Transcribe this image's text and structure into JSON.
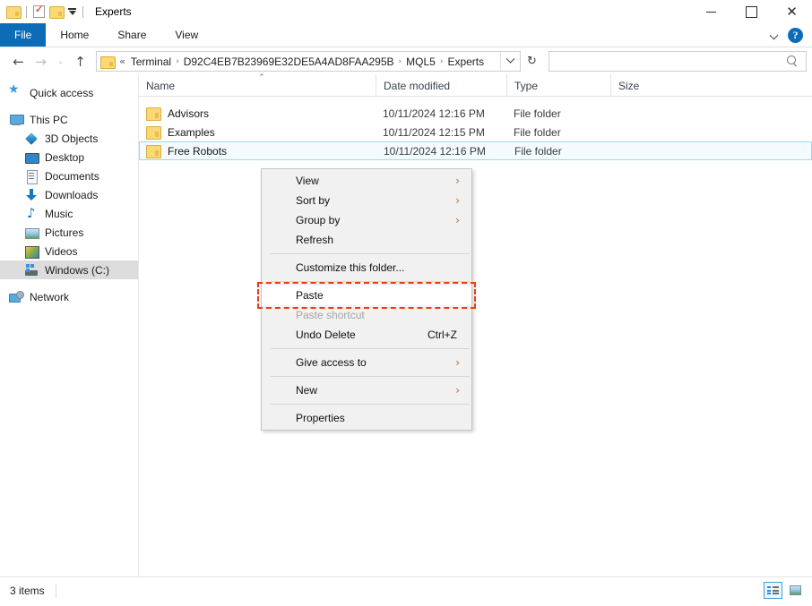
{
  "window": {
    "title": "Experts",
    "quick_access": [
      "folder-icon",
      "properties-icon",
      "new-folder-icon"
    ],
    "controls": {
      "minimize": "minimize-icon",
      "maximize": "maximize-icon",
      "close": "✕"
    }
  },
  "ribbon": {
    "tabs": [
      {
        "label": "File",
        "active": true
      },
      {
        "label": "Home",
        "active": false
      },
      {
        "label": "Share",
        "active": false
      },
      {
        "label": "View",
        "active": false
      }
    ],
    "expand_icon": "chevron-down-icon",
    "help_label": "?"
  },
  "navigation": {
    "back": "←",
    "forward": "→",
    "recent": "⌄",
    "up": "↑",
    "refresh": "↻",
    "address_caret": "chevron-down-icon",
    "breadcrumb": {
      "overflow": "«",
      "items": [
        "Terminal",
        "D92C4EB7B23969E32DE5A4AD8FAA295B",
        "MQL5",
        "Experts"
      ],
      "separator": "›"
    },
    "search": {
      "value": "",
      "placeholder": "",
      "icon": "search-icon"
    }
  },
  "sidebar": {
    "items": [
      {
        "label": "Quick access",
        "icon": "star-icon",
        "indent": false,
        "selected": false
      },
      {
        "label": "This PC",
        "icon": "computer-icon",
        "indent": false,
        "selected": false
      },
      {
        "label": "3D Objects",
        "icon": "3d-objects-icon",
        "indent": true,
        "selected": false
      },
      {
        "label": "Desktop",
        "icon": "desktop-icon",
        "indent": true,
        "selected": false
      },
      {
        "label": "Documents",
        "icon": "documents-icon",
        "indent": true,
        "selected": false
      },
      {
        "label": "Downloads",
        "icon": "downloads-icon",
        "indent": true,
        "selected": false
      },
      {
        "label": "Music",
        "icon": "music-icon",
        "indent": true,
        "selected": false
      },
      {
        "label": "Pictures",
        "icon": "pictures-icon",
        "indent": true,
        "selected": false
      },
      {
        "label": "Videos",
        "icon": "videos-icon",
        "indent": true,
        "selected": false
      },
      {
        "label": "Windows (C:)",
        "icon": "drive-icon",
        "indent": true,
        "selected": true
      },
      {
        "label": "Network",
        "icon": "network-icon",
        "indent": false,
        "selected": false
      }
    ]
  },
  "filelist": {
    "columns": [
      "Name",
      "Date modified",
      "Type",
      "Size"
    ],
    "sort_indicator": "⌃",
    "rows": [
      {
        "name": "Advisors",
        "date": "10/11/2024 12:16 PM",
        "type": "File folder",
        "size": "",
        "selected": false
      },
      {
        "name": "Examples",
        "date": "10/11/2024 12:15 PM",
        "type": "File folder",
        "size": "",
        "selected": false
      },
      {
        "name": "Free Robots",
        "date": "10/11/2024 12:16 PM",
        "type": "File folder",
        "size": "",
        "selected": true
      }
    ]
  },
  "context_menu": {
    "items": [
      {
        "label": "View",
        "submenu": true,
        "disabled": false,
        "accel": "",
        "highlighted": false,
        "separator_after": false
      },
      {
        "label": "Sort by",
        "submenu": true,
        "disabled": false,
        "accel": "",
        "highlighted": false,
        "separator_after": false
      },
      {
        "label": "Group by",
        "submenu": true,
        "disabled": false,
        "accel": "",
        "highlighted": false,
        "separator_after": false
      },
      {
        "label": "Refresh",
        "submenu": false,
        "disabled": false,
        "accel": "",
        "highlighted": false,
        "separator_after": true
      },
      {
        "label": "Customize this folder...",
        "submenu": false,
        "disabled": false,
        "accel": "",
        "highlighted": false,
        "separator_after": true
      },
      {
        "label": "Paste",
        "submenu": false,
        "disabled": false,
        "accel": "",
        "highlighted": true,
        "separator_after": false
      },
      {
        "label": "Paste shortcut",
        "submenu": false,
        "disabled": true,
        "accel": "",
        "highlighted": false,
        "separator_after": false
      },
      {
        "label": "Undo Delete",
        "submenu": false,
        "disabled": false,
        "accel": "Ctrl+Z",
        "highlighted": false,
        "separator_after": true
      },
      {
        "label": "Give access to",
        "submenu": true,
        "disabled": false,
        "accel": "",
        "highlighted": false,
        "separator_after": true
      },
      {
        "label": "New",
        "submenu": true,
        "disabled": false,
        "accel": "",
        "highlighted": false,
        "separator_after": true
      },
      {
        "label": "Properties",
        "submenu": false,
        "disabled": false,
        "accel": "",
        "highlighted": false,
        "separator_after": false
      }
    ],
    "submenu_arrow": "›",
    "highlight_color": "#f23a12"
  },
  "statusbar": {
    "item_count": "3 items",
    "view_details": "details-view-icon",
    "view_thumbnails": "thumbnail-view-icon"
  }
}
